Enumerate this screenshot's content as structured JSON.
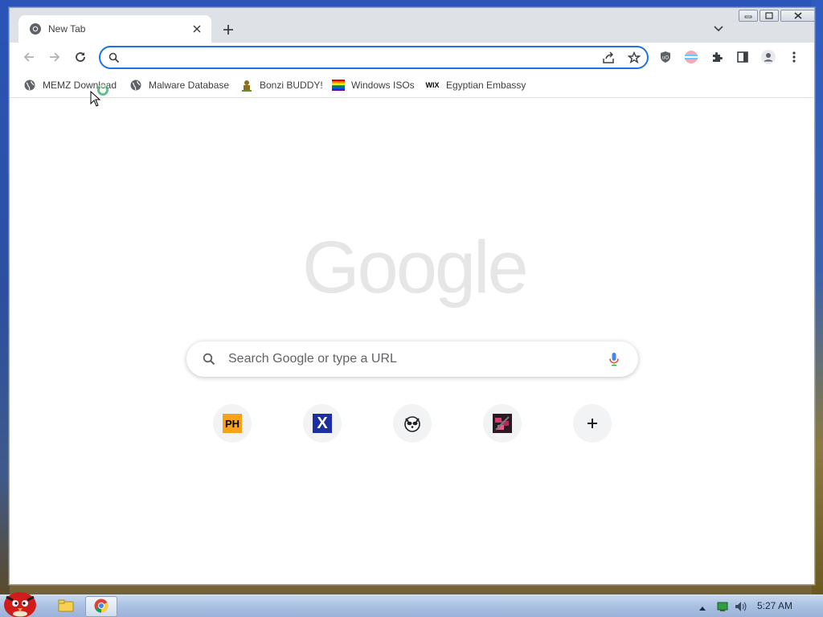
{
  "browser": {
    "tab": {
      "title": "New Tab"
    },
    "omnibox": {
      "value": "",
      "placeholder": ""
    }
  },
  "bookmarks": [
    {
      "label": "MEMZ Download",
      "icon": "globe-icon"
    },
    {
      "label": "Malware Database",
      "icon": "globe-icon"
    },
    {
      "label": "Bonzi BUDDY!",
      "icon": "bonzi-icon"
    },
    {
      "label": "Windows ISOs",
      "icon": "windows-flag-icon"
    },
    {
      "label": "Egyptian Embassy",
      "icon": "wix-icon"
    }
  ],
  "ntp": {
    "logo": "Google",
    "search_placeholder": "Search Google or type a URL",
    "shortcuts": [
      {
        "label": "",
        "icon": "ph-icon",
        "badge": "PH"
      },
      {
        "label": "",
        "icon": "x-icon",
        "badge": "X"
      },
      {
        "label": "",
        "icon": "raccoon-icon"
      },
      {
        "label": "",
        "icon": "pixel-art-icon"
      },
      {
        "label": "",
        "icon": "add-shortcut-icon"
      }
    ]
  },
  "taskbar": {
    "clock": "5:27 AM"
  },
  "colors": {
    "accent": "#1a73e8",
    "tabstrip": "#dee1e6",
    "taskbar": "#a9c0e2"
  }
}
